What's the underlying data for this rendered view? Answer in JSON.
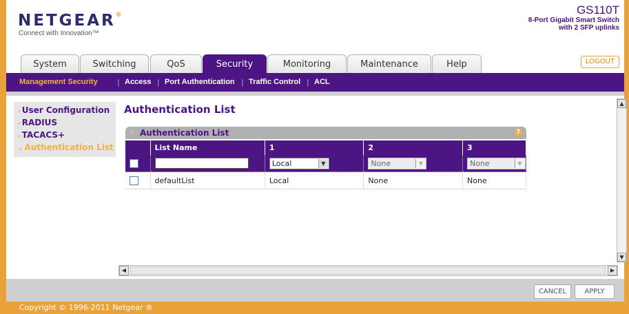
{
  "brand": {
    "logo_text": "NETGEAR",
    "logo_mark": "®",
    "tagline": "Connect with Innovation™",
    "model": "GS110T",
    "model_desc_1": "8-Port Gigabit Smart Switch",
    "model_desc_2": "with 2 SFP uplinks",
    "accent_purple": "#4d1583",
    "accent_orange": "#e9a13a"
  },
  "header": {
    "logout_label": "LOGOUT",
    "tabs": [
      {
        "label": "System"
      },
      {
        "label": "Switching"
      },
      {
        "label": "QoS"
      },
      {
        "label": "Security",
        "active": true
      },
      {
        "label": "Monitoring"
      },
      {
        "label": "Maintenance"
      },
      {
        "label": "Help"
      }
    ]
  },
  "subnav": {
    "items": [
      {
        "label": "Management Security",
        "active": true
      },
      {
        "label": "Access"
      },
      {
        "label": "Port Authentication"
      },
      {
        "label": "Traffic Control"
      },
      {
        "label": "ACL"
      }
    ],
    "separator": "|"
  },
  "sidebar": {
    "items": [
      {
        "label": "User Configuration",
        "bullet": "›"
      },
      {
        "label": "RADIUS",
        "bullet": "›"
      },
      {
        "label": "TACACS+",
        "bullet": "›"
      },
      {
        "label": "Authentication List",
        "bullet": "⌄",
        "active": true
      }
    ]
  },
  "main": {
    "page_title": "Authentication List",
    "panel_title": "Authentication List",
    "help_glyph": "?",
    "columns": [
      "",
      "List Name",
      "1",
      "2",
      "3"
    ],
    "edit_row": {
      "list_name_value": "",
      "method1": "Local",
      "method2": "None",
      "method3": "None"
    },
    "rows": [
      {
        "list_name": "defaultList",
        "m1": "Local",
        "m2": "None",
        "m3": "None"
      }
    ]
  },
  "actions": {
    "cancel_label": "CANCEL",
    "apply_label": "APPLY"
  },
  "footer": {
    "copyright": "Copyright © 1996-2011 Netgear ®"
  }
}
